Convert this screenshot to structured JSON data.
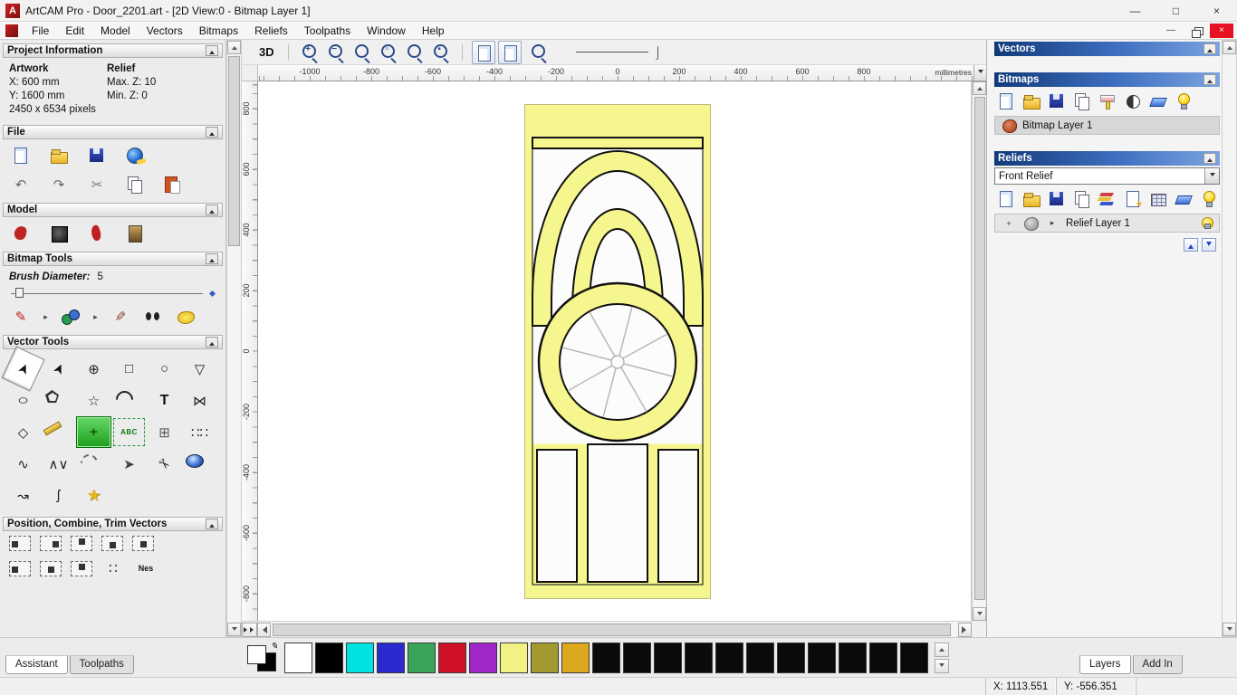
{
  "window": {
    "title": "ArtCAM Pro - Door_2201.art - [2D View:0 - Bitmap Layer 1]",
    "controls": [
      {
        "name": "minimize-button",
        "glyph": "—"
      },
      {
        "name": "maximize-button",
        "glyph": "□"
      },
      {
        "name": "close-button",
        "glyph": "×"
      }
    ],
    "mdi_controls": [
      {
        "name": "mdi-minimize-button",
        "glyph": "—"
      },
      {
        "name": "mdi-restore-button",
        "cls": "ic-restore"
      },
      {
        "name": "mdi-close-button",
        "glyph": "×",
        "cls": "mdi-close"
      }
    ]
  },
  "menu": {
    "items": [
      "File",
      "Edit",
      "Model",
      "Vectors",
      "Bitmaps",
      "Reliefs",
      "Toolpaths",
      "Window",
      "Help"
    ]
  },
  "assistant": {
    "project_information": {
      "title": "Project Information",
      "artwork": {
        "label": "Artwork",
        "x": "X: 600 mm",
        "y": "Y: 1600 mm",
        "pixels": "2450 x 6534 pixels"
      },
      "relief": {
        "label": "Relief",
        "max_z": "Max. Z: 10",
        "min_z": "Min. Z: 0"
      }
    },
    "file": {
      "title": "File",
      "row1": [
        {
          "name": "new-model-icon",
          "cls": "ic-page"
        },
        {
          "name": "open-model-icon",
          "cls": "ic-folder"
        },
        {
          "name": "save-model-icon",
          "cls": "ic-disk"
        },
        {
          "name": "import-export-icon",
          "cls": "ic-world"
        }
      ],
      "row2": [
        {
          "name": "undo-icon",
          "glyph": "↶",
          "color": "#6a6a6a"
        },
        {
          "name": "redo-icon",
          "glyph": "↷",
          "color": "#6a6a6a"
        },
        {
          "name": "cut-icon",
          "glyph": "✂",
          "color": "#777777"
        },
        {
          "name": "copy-icon",
          "cls": "ic-copy"
        },
        {
          "name": "paste-icon",
          "cls": "ic-paste"
        }
      ]
    },
    "model": {
      "title": "Model",
      "icons": [
        {
          "name": "set-model-size-icon",
          "cls": "ic-redblob"
        },
        {
          "name": "invert-relief-icon",
          "cls": "ic-dark"
        },
        {
          "name": "sculpting-icon",
          "cls": "ic-redblob2"
        },
        {
          "name": "load-greyscale-icon",
          "cls": "ic-mona"
        }
      ]
    },
    "bitmap_tools": {
      "title": "Bitmap Tools",
      "brush_label": "Brush Diameter:",
      "brush_value": "5",
      "icons": [
        {
          "name": "paint-brush-icon",
          "glyph": "✎",
          "color": "#c22222"
        },
        {
          "name": "flyout-arrow-icon",
          "glyph": "▸",
          "cls": "tiny"
        },
        {
          "name": "flood-fill-icon",
          "cls": "ic-fill"
        },
        {
          "name": "flyout-arrow-icon",
          "glyph": "▸",
          "cls": "tiny"
        },
        {
          "name": "colour-picker-icon",
          "glyph": "✎",
          "color": "#884433",
          "cls": "flipx"
        },
        {
          "name": "link-colours-icon",
          "cls": "ic-eyes"
        },
        {
          "name": "bitmap-colour-icon",
          "cls": "ic-yellowblob"
        }
      ]
    },
    "vector_tools": {
      "title": "Vector Tools",
      "tools": [
        {
          "name": "select-vectors-icon",
          "glyph": "➤",
          "cls": "rot-cursor",
          "color": "#111111",
          "pressed": true
        },
        {
          "name": "node-editing-icon",
          "glyph": "➤",
          "cls": "rot-cursor",
          "color": "#111111"
        },
        {
          "name": "transform-vectors-icon",
          "glyph": "⊕",
          "color": "#222222"
        },
        {
          "name": "create-rectangle-icon",
          "glyph": "□",
          "color": "#222222"
        },
        {
          "name": "create-circle-icon",
          "glyph": "○",
          "color": "#222222"
        },
        {
          "name": "create-shape-icon",
          "glyph": "▽",
          "color": "#222222"
        },
        {
          "name": "create-ellipse-icon",
          "glyph": "○",
          "cls": "squash",
          "color": "#222222"
        },
        {
          "name": "create-polygon-icon",
          "cls": "ic-pentagon"
        },
        {
          "name": "create-star-icon",
          "glyph": "☆",
          "color": "#222222"
        },
        {
          "name": "create-arc-icon",
          "cls": "ic-arc"
        },
        {
          "name": "create-text-icon",
          "glyph": "T",
          "cls": "bold",
          "color": "#111111"
        },
        {
          "name": "mirror-vectors-icon",
          "glyph": "⋈",
          "color": "#222222"
        },
        {
          "name": "offset-vectors-icon",
          "glyph": "◇",
          "color": "#222222"
        },
        {
          "name": "measure-icon",
          "cls": "ic-measure"
        },
        {
          "name": "block-copy-icon",
          "cls": "ic-greenplus",
          "glyph": "+"
        },
        {
          "name": "vectorise-bitmap-icon",
          "glyph": "ABC",
          "cls": "ic-abc"
        },
        {
          "name": "snap-grid-icon",
          "glyph": "⊞",
          "color": "#555555"
        },
        {
          "name": "array-copy-icon",
          "glyph": "∷∷",
          "color": "#333333"
        },
        {
          "name": "fit-curve-icon",
          "glyph": "∿",
          "color": "#222222"
        },
        {
          "name": "create-polyline-icon",
          "glyph": "∧∨",
          "color": "#222222"
        },
        {
          "name": "arc-fit-icon",
          "cls": "ic-arc dashed"
        },
        {
          "name": "join-vectors-icon",
          "glyph": "➤",
          "color": "#444444"
        },
        {
          "name": "trim-vectors-icon",
          "glyph": "✂",
          "cls": "rot45",
          "color": "#222222"
        },
        {
          "name": "spin-profile-icon",
          "cls": "ic-disc3d"
        },
        {
          "name": "fillet-icon",
          "glyph": "↝",
          "color": "#222222"
        },
        {
          "name": "wrap-text-icon",
          "glyph": "ʃ",
          "color": "#222222"
        },
        {
          "name": "star-wizard-icon",
          "glyph": "★",
          "color": "#e8b820",
          "cls": "shadowed"
        }
      ]
    },
    "position_tools": {
      "title": "Position, Combine, Trim Vectors",
      "row1": [
        {
          "name": "align-left-icon",
          "cls": "ic-align al-left"
        },
        {
          "name": "align-right-icon",
          "cls": "ic-align al-right"
        },
        {
          "name": "align-top-icon",
          "cls": "ic-align al-top"
        },
        {
          "name": "align-bottom-icon",
          "cls": "ic-align al-bottom"
        },
        {
          "name": "align-centre-icon",
          "cls": "ic-align al-center"
        }
      ],
      "row2": [
        {
          "name": "spread-vectors-icon",
          "cls": "ic-align al-left"
        },
        {
          "name": "centre-in-page-icon",
          "cls": "ic-align al-center"
        },
        {
          "name": "move-to-top-icon",
          "cls": "ic-align al-top"
        },
        {
          "name": "scatter-copies-icon",
          "glyph": "∷",
          "color": "#333333"
        },
        {
          "name": "nesting-icon",
          "glyph": "Nes",
          "cls": "ic-nes"
        }
      ]
    },
    "tabs": [
      {
        "label": "Assistant",
        "active": true
      },
      {
        "label": "Toolpaths",
        "active": false
      }
    ]
  },
  "canvas": {
    "toolbar": {
      "view_3d": "3D",
      "zoom": [
        {
          "name": "zoom-in-icon",
          "cls": "ic-zoom",
          "glyph": "+"
        },
        {
          "name": "zoom-out-icon",
          "cls": "ic-zoom",
          "glyph": "−"
        },
        {
          "name": "zoom-previous-icon",
          "cls": "ic-zoom"
        },
        {
          "name": "zoom-window-icon",
          "cls": "ic-zoom",
          "glyph": "▫"
        },
        {
          "name": "zoom-extents-icon",
          "cls": "ic-zoom"
        },
        {
          "name": "zoom-objects-icon",
          "cls": "ic-zoom",
          "glyph": "▪"
        }
      ],
      "toggles": [
        {
          "name": "page-forward-icon",
          "cls": "ic-page tb",
          "glyph": "→",
          "color": "#2255cc"
        },
        {
          "name": "page-back-icon",
          "cls": "ic-page tb",
          "glyph": "←",
          "color": "#2255cc"
        }
      ],
      "extra": [
        {
          "name": "zoom-scale-icon",
          "cls": "ic-zoom"
        }
      ]
    },
    "ruler": {
      "h_labels": [
        "-1000",
        "-800",
        "-600",
        "-400",
        "-200",
        "0",
        "200",
        "400",
        "600",
        "800"
      ],
      "v_labels": [
        "800",
        "600",
        "400",
        "200",
        "0",
        "-200",
        "-400",
        "-600",
        "-800"
      ],
      "unit": "millimetres"
    }
  },
  "layers_panel": {
    "vectors_title": "Vectors",
    "bitmaps_title": "Bitmaps",
    "bitmaps_toolbar": [
      {
        "name": "new-bitmap-layer-icon",
        "cls": "ic-page"
      },
      {
        "name": "open-bitmap-layer-icon",
        "cls": "ic-folder"
      },
      {
        "name": "save-bitmap-layer-icon",
        "cls": "ic-disk"
      },
      {
        "name": "copy-bitmap-layer-icon",
        "cls": "ic-copy"
      },
      {
        "name": "paint-selection-icon",
        "cls": "ic-paint"
      },
      {
        "name": "contrast-icon",
        "cls": "ic-contrast"
      },
      {
        "name": "delete-bitmap-layer-icon",
        "cls": "ic-eraser"
      },
      {
        "name": "toggle-all-visibility-icon",
        "cls": "ic-bulb"
      }
    ],
    "bitmap_row_lead": [
      {
        "name": "bitmap-layer-thumb-icon",
        "cls": "ic-bblob"
      }
    ],
    "bitmap_layers": [
      {
        "name": "Bitmap Layer 1"
      }
    ],
    "reliefs_title": "Reliefs",
    "relief_combo_value": "Front Relief",
    "reliefs_toolbar": [
      {
        "name": "new-relief-layer-icon",
        "cls": "ic-page"
      },
      {
        "name": "open-relief-layer-icon",
        "cls": "ic-folder"
      },
      {
        "name": "save-relief-layer-icon",
        "cls": "ic-disk"
      },
      {
        "name": "copy-relief-layer-icon",
        "cls": "ic-copy"
      },
      {
        "name": "relief-stack-icon",
        "cls": "ic-layers"
      },
      {
        "name": "new-layer-from-relief-icon",
        "cls": "ic-pagestar"
      },
      {
        "name": "calculate-relief-icon",
        "cls": "ic-grid"
      },
      {
        "name": "delete-relief-layer-icon",
        "cls": "ic-eraser"
      },
      {
        "name": "relief-visibility-icon",
        "cls": "ic-bulb"
      }
    ],
    "relief_row_lead": [
      {
        "name": "add-sublayer-icon",
        "glyph": "+",
        "cls": "tiny"
      },
      {
        "name": "relief-layer-thumb-icon",
        "cls": "ic-gblob"
      },
      {
        "name": "expand-arrow-icon",
        "glyph": "▸",
        "cls": "tiny"
      }
    ],
    "relief_row_trail": [
      {
        "name": "relief-layer-visibility-icon",
        "cls": "ic-bulb"
      }
    ],
    "relief_layers": [
      {
        "name": "Relief Layer 1"
      }
    ],
    "tabs": [
      {
        "label": "Layers",
        "active": true
      },
      {
        "label": "Add In",
        "active": false
      }
    ]
  },
  "palette": {
    "colors": [
      "#ffffff",
      "#000000",
      "#00e1e1",
      "#2a2ad0",
      "#3aa55a",
      "#d01228",
      "#a028c8",
      "#f2f284",
      "#a29a2e",
      "#dca81e",
      "#0a0a0a",
      "#0a0a0a",
      "#0a0a0a",
      "#0a0a0a",
      "#0a0a0a",
      "#0a0a0a",
      "#0a0a0a",
      "#0a0a0a",
      "#0a0a0a",
      "#0a0a0a",
      "#0a0a0a"
    ]
  },
  "status_bar": {
    "x": "X: 1113.551",
    "y": "Y: -556.351"
  }
}
